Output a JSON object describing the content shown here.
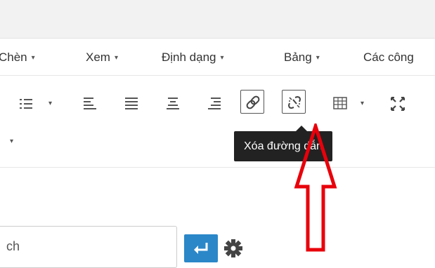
{
  "menubar": {
    "items": [
      {
        "label": "Chèn",
        "caret": "▾"
      },
      {
        "label": "Xem",
        "caret": "▾"
      },
      {
        "label": "Định dạng",
        "caret": "▾"
      },
      {
        "label": "Bảng",
        "caret": "▾"
      },
      {
        "label": "Các công",
        "caret": ""
      }
    ]
  },
  "toolbar": {
    "icons": [
      "numbered-list-icon",
      "align-left-icon",
      "align-justify-icon",
      "align-center-icon",
      "align-right-icon",
      "insert-link-icon",
      "remove-link-icon",
      "table-icon",
      "fullscreen-icon"
    ],
    "caret": "▾",
    "active_button_border": "#555555"
  },
  "tooltip": {
    "text": "Xóa đường dẫn"
  },
  "search": {
    "value": "ch",
    "submit_icon": "enter-icon",
    "settings_icon": "gear-icon",
    "submit_color": "#2b87c8"
  },
  "annotation": {
    "arrow_color": "#e8000b"
  }
}
